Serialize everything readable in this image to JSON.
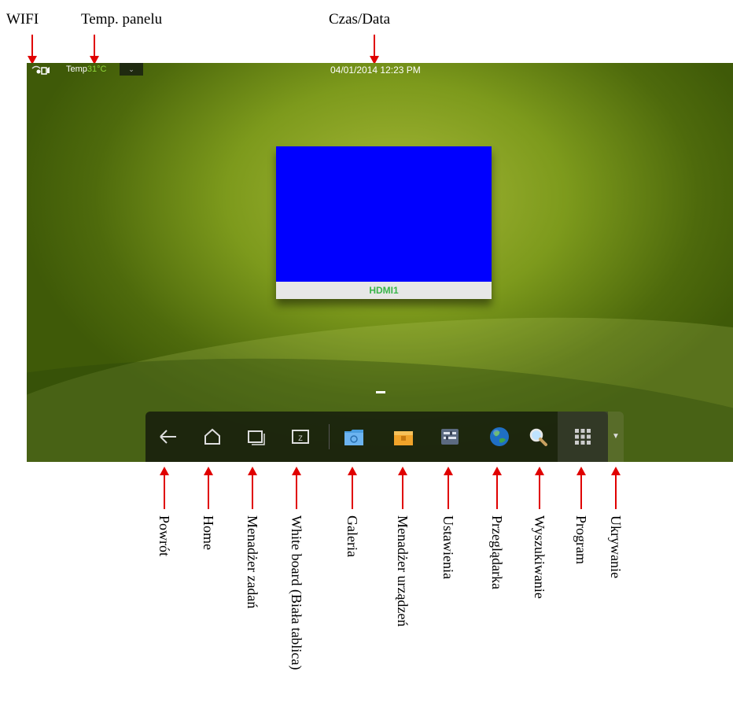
{
  "annotations_top": {
    "wifi": "WIFI",
    "temp_panel": "Temp. panelu",
    "time_date": "Czas/Data"
  },
  "status_bar": {
    "temp_prefix": "Temp",
    "temp_value": "31°C",
    "dropdown_glyph": "⌄",
    "datetime": "04/01/2014 12:23  PM"
  },
  "source": {
    "label": "HDMI1",
    "preview_color": "#0000ff",
    "label_color": "#39b54a"
  },
  "dock": {
    "hide_glyph": "▼",
    "whiteboard_glyph": "Z"
  },
  "annotations_bottom": {
    "back": "Powrót",
    "home": "Home",
    "task_manager": "Menadżer zadań",
    "whiteboard": "White board (Biała tablica)",
    "gallery": "Galeria",
    "device_manager": "Menadżer urządzeń",
    "settings": "Ustawienia",
    "browser": "Przeglądarka",
    "search": "Wyszukiwanie",
    "program": "Program",
    "hide": "Ukrywanie"
  },
  "colors": {
    "arrow": "#e00000",
    "desktop_green": "#7d9a1c"
  },
  "icons": [
    "wifi-icon",
    "back-icon",
    "home-icon",
    "task-manager-icon",
    "whiteboard-icon",
    "gallery-icon",
    "device-manager-icon",
    "settings-icon",
    "browser-globe-icon",
    "search-magnifier-icon",
    "program-grid-icon",
    "hide-triangle-icon"
  ]
}
